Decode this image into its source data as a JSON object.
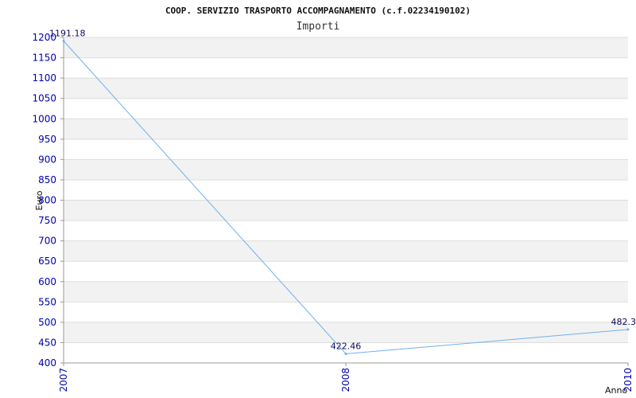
{
  "chart_data": {
    "type": "line",
    "title": "COOP. SERVIZIO TRASPORTO ACCOMPAGNAMENTO (c.f.02234190102)",
    "subtitle": "Importi",
    "xlabel": "Anno",
    "ylabel": "Euro",
    "categories": [
      "2007",
      "2008",
      "2010"
    ],
    "series": [
      {
        "values": [
          1191.18,
          422.46,
          482.3
        ],
        "labels": [
          "1191.18",
          "422.46",
          "482.3"
        ]
      }
    ],
    "ylim": [
      400,
      1200
    ],
    "yticks": [
      "400",
      "450",
      "500",
      "550",
      "600",
      "650",
      "700",
      "750",
      "800",
      "850",
      "900",
      "950",
      "1000",
      "1050",
      "1100",
      "1150",
      "1200"
    ],
    "grid": true,
    "colors": {
      "line": "#6fb0ef",
      "band": "#f2f2f2",
      "gridline": "#dddddd",
      "tick": "#0000aa"
    }
  }
}
